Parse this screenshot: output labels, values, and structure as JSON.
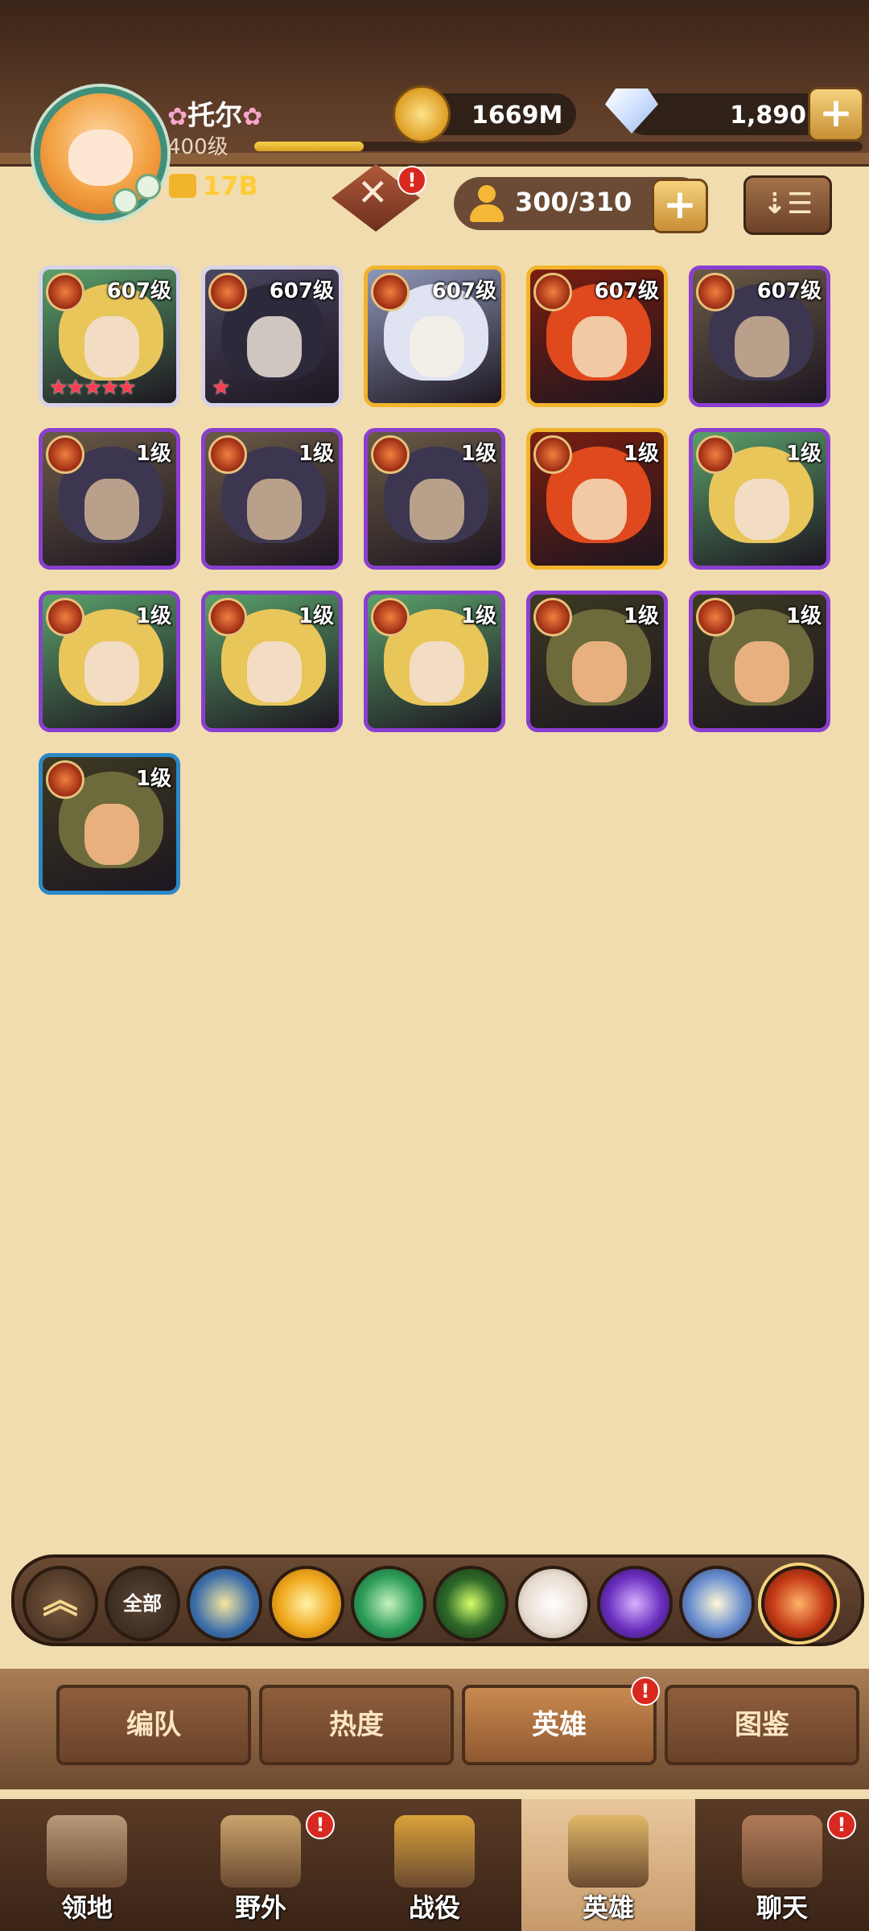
{
  "player": {
    "name": "托尔",
    "level": "400级",
    "xp_fraction": 0.18,
    "power": "17B"
  },
  "resources": {
    "gold": "1669M",
    "diamonds": "1,890"
  },
  "hero_capacity": "300/310",
  "heroes": [
    {
      "level": "607级",
      "rarity": "white",
      "stars": "★★★★★",
      "palette": "blonde"
    },
    {
      "level": "607级",
      "rarity": "white",
      "stars": "★",
      "palette": "dark-horned"
    },
    {
      "level": "607级",
      "rarity": "gold",
      "stars": "",
      "palette": "silver-elf"
    },
    {
      "level": "607级",
      "rarity": "gold",
      "stars": "",
      "palette": "red-hair"
    },
    {
      "level": "607级",
      "rarity": "purple",
      "stars": "",
      "palette": "helmet"
    },
    {
      "level": "1级",
      "rarity": "purple",
      "stars": "",
      "palette": "helmet"
    },
    {
      "level": "1级",
      "rarity": "purple",
      "stars": "",
      "palette": "helmet"
    },
    {
      "level": "1级",
      "rarity": "purple",
      "stars": "",
      "palette": "helmet"
    },
    {
      "level": "1级",
      "rarity": "gold",
      "stars": "",
      "palette": "red-hair"
    },
    {
      "level": "1级",
      "rarity": "purple",
      "stars": "",
      "palette": "blonde"
    },
    {
      "level": "1级",
      "rarity": "purple",
      "stars": "",
      "palette": "blonde"
    },
    {
      "level": "1级",
      "rarity": "purple",
      "stars": "",
      "palette": "blonde"
    },
    {
      "level": "1级",
      "rarity": "purple",
      "stars": "",
      "palette": "blonde"
    },
    {
      "level": "1级",
      "rarity": "purple",
      "stars": "",
      "palette": "hooded"
    },
    {
      "level": "1级",
      "rarity": "purple",
      "stars": "",
      "palette": "hooded"
    },
    {
      "level": "1级",
      "rarity": "blue",
      "stars": "",
      "palette": "hooded"
    }
  ],
  "filters": {
    "all_label": "全部",
    "items": [
      "all",
      "light",
      "sun",
      "nature",
      "eye",
      "star",
      "void",
      "moon",
      "fire"
    ]
  },
  "subtabs": [
    "编队",
    "热度",
    "英雄",
    "图鉴"
  ],
  "subtab_active": 2,
  "nav": [
    {
      "label": "领地",
      "icon": "castle-icon",
      "alert": false
    },
    {
      "label": "野外",
      "icon": "scroll-map-icon",
      "alert": true
    },
    {
      "label": "战役",
      "icon": "battle-emblem-icon",
      "alert": false
    },
    {
      "label": "英雄",
      "icon": "helmet-icon",
      "alert": false,
      "active": true
    },
    {
      "label": "聊天",
      "icon": "chat-hood-icon",
      "alert": true
    }
  ],
  "colors": {
    "background": "#f0dcae",
    "rarity_purple": "#8a3fd0",
    "rarity_gold": "#f2b42b",
    "rarity_white": "#d8d2e8",
    "rarity_blue": "#2a87c8",
    "alert": "#d9281f"
  }
}
